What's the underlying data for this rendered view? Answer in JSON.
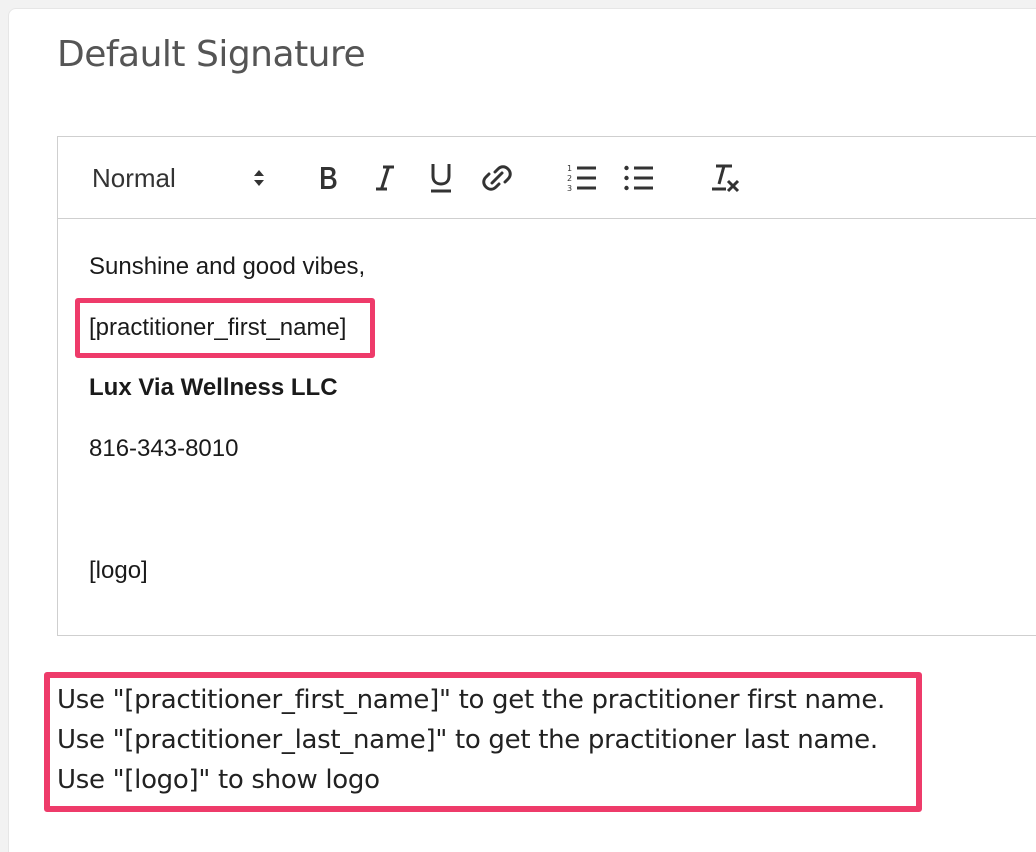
{
  "section_title": "Default Signature",
  "toolbar": {
    "format_select_value": "Normal",
    "buttons": [
      {
        "name": "bold-icon"
      },
      {
        "name": "italic-icon"
      },
      {
        "name": "underline-icon"
      },
      {
        "name": "link-icon"
      },
      {
        "name": "ordered-list-icon"
      },
      {
        "name": "bullet-list-icon"
      },
      {
        "name": "clear-format-icon"
      }
    ]
  },
  "editor": {
    "lines": [
      "Sunshine and good vibes,",
      "[practitioner_first_name]",
      "Lux Via Wellness LLC",
      "816-343-8010",
      "[logo]"
    ]
  },
  "hints": [
    "Use \"[practitioner_first_name]\" to get the practitioner first name.",
    "Use \"[practitioner_last_name]\" to get the practitioner last name.",
    "Use \"[logo]\" to show logo"
  ],
  "colors": {
    "highlight": "#ee3b6a",
    "title": "#555555",
    "border": "#cfcfcf"
  }
}
